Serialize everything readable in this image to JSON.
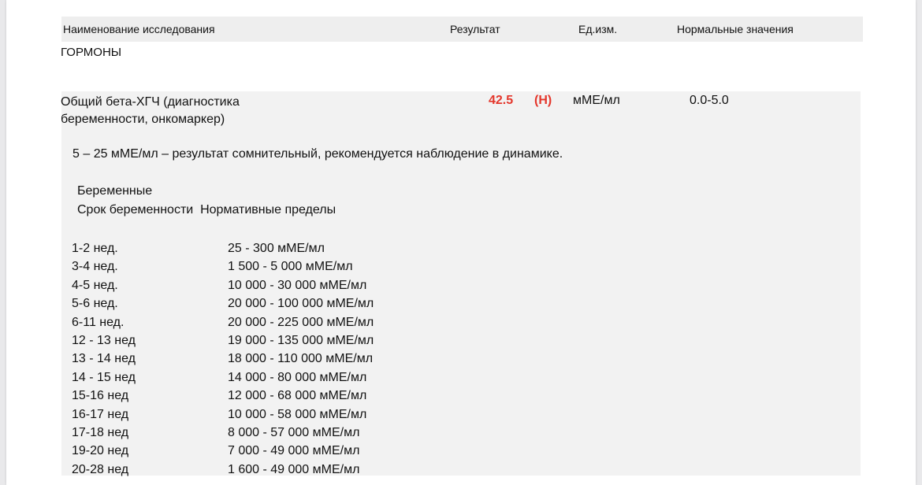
{
  "header": {
    "name": "Наименование исследования",
    "result": "Результат",
    "unit": "Ед.изм.",
    "normal": "Нормальные значения"
  },
  "section": "ГОРМОНЫ",
  "test": {
    "name": "Общий бета-ХГЧ (диагностика беременности, онкомаркер)",
    "result": "42.5",
    "flag": "(Н)",
    "unit": "мМЕ/мл",
    "normal": "0.0-5.0",
    "result_color": "#e4362b"
  },
  "comment": {
    "line": "5 – 25 мМЕ/мл – результат сомнительный, рекомендуется наблюдение в динамике.",
    "pregnant_title": "Беременные",
    "column_header": "Срок беременности  Нормативные пределы"
  },
  "reference": [
    {
      "term": "1-2 нед.",
      "range": "25 - 300 мМЕ/мл"
    },
    {
      "term": "3-4 нед.",
      "range": "1 500 - 5 000 мМЕ/мл"
    },
    {
      "term": "4-5 нед.",
      "range": "10 000 - 30 000 мМЕ/мл"
    },
    {
      "term": "5-6 нед.",
      "range": "20 000 - 100 000 мМЕ/мл"
    },
    {
      "term": "6-11 нед.",
      "range": "20 000 - 225 000 мМЕ/мл"
    },
    {
      "term": "12 - 13 нед",
      "range": "19 000 - 135 000 мМЕ/мл"
    },
    {
      "term": "13 - 14 нед",
      "range": "18 000 - 110 000 мМЕ/мл"
    },
    {
      "term": "14 - 15 нед",
      "range": "14 000 - 80 000 мМЕ/мл"
    },
    {
      "term": "15-16 нед",
      "range": "12 000 - 68 000 мМЕ/мл"
    },
    {
      "term": "16-17 нед",
      "range": "10 000 - 58 000 мМЕ/мл"
    },
    {
      "term": "17-18 нед",
      "range": "8 000 - 57 000 мМЕ/мл"
    },
    {
      "term": "19-20 нед",
      "range": "7 000 - 49 000 мМЕ/мл"
    },
    {
      "term": "20-28 нед",
      "range": "1 600 - 49 000 мМЕ/мл"
    }
  ]
}
